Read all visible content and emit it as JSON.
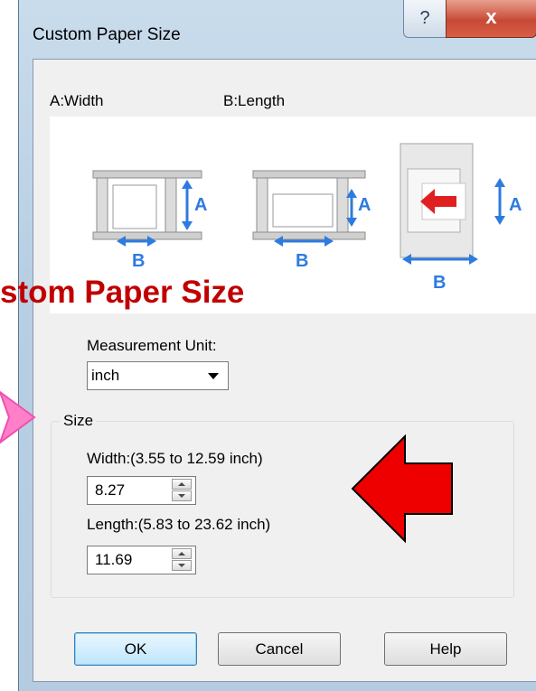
{
  "window": {
    "title": "Custom Paper Size",
    "help_button": "?",
    "close_button": "x"
  },
  "diagram": {
    "width_label": "A:Width",
    "length_label": "B:Length",
    "dimension_a": "A",
    "dimension_b": "B",
    "arrow_color": "#2e7be0",
    "red_arrow_color": "#e02020"
  },
  "overlay": {
    "title_fragment": "stom Paper Size",
    "color": "#c00000"
  },
  "measurement_unit": {
    "label": "Measurement Unit:",
    "selected": "inch"
  },
  "size_group": {
    "legend": "Size",
    "width": {
      "label": "Width:(3.55 to 12.59 inch)",
      "value": "8.27"
    },
    "length": {
      "label": "Length:(5.83 to 23.62 inch)",
      "value": "11.69"
    }
  },
  "buttons": {
    "ok": "OK",
    "cancel": "Cancel",
    "help": "Help"
  },
  "annotation": {
    "big_arrow_color": "#ee0000"
  }
}
